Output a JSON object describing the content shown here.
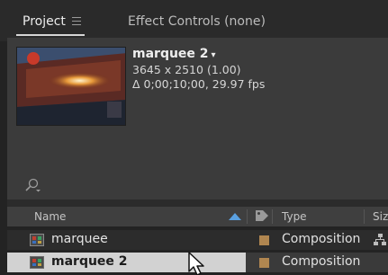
{
  "tabs": {
    "project": "Project",
    "effect_controls": "Effect Controls (none)"
  },
  "preview": {
    "title": "marquee 2",
    "title_caret": "▾",
    "dimensions": "3645 x 2510 (1.00)",
    "duration": "Δ 0;00;10;00, 29.97 fps"
  },
  "search": {
    "icon": "search-icon"
  },
  "columns": {
    "name": "Name",
    "type": "Type",
    "size": "Siz"
  },
  "items": [
    {
      "name": "marquee",
      "type": "Composition",
      "label_color": "#b08650",
      "selected": false
    },
    {
      "name": "marquee 2",
      "type": "Composition",
      "label_color": "#b08650",
      "selected": true
    }
  ],
  "colors": {
    "panel_bg": "#3b3b3b",
    "selection_bg": "#d2d2d2",
    "label_sandstone": "#b08650"
  }
}
